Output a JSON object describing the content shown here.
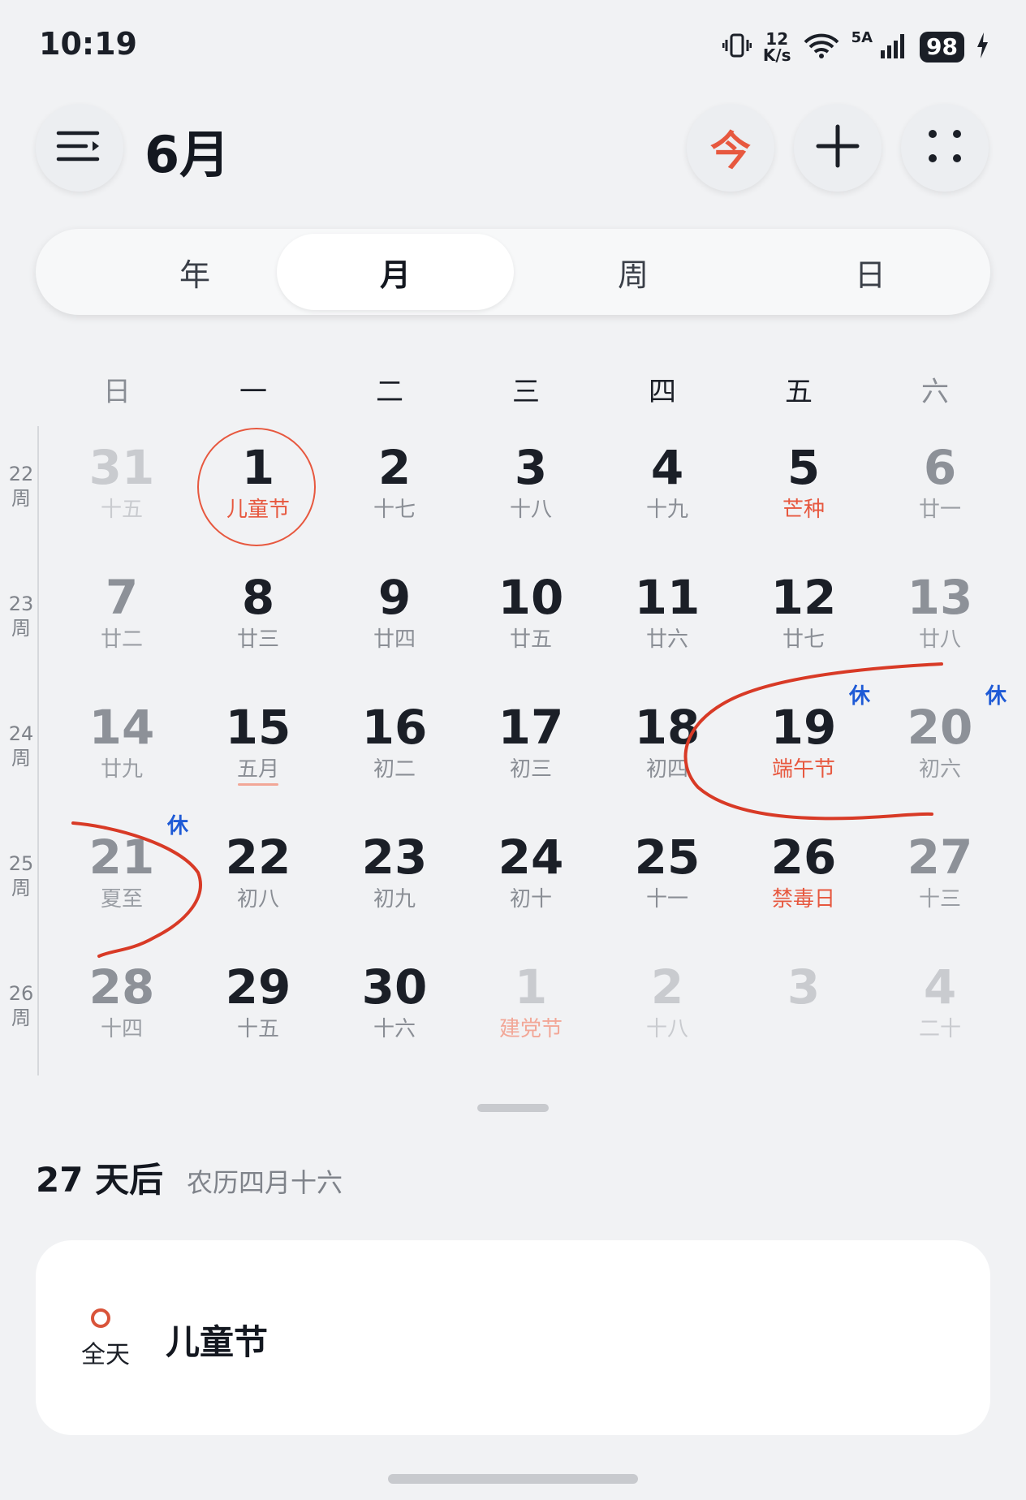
{
  "status_bar": {
    "time": "10:19",
    "net_speed_value": "12",
    "net_speed_unit": "K/s",
    "signal_label": "5A",
    "battery": "98"
  },
  "header": {
    "month_title": "6月",
    "today_label": "今",
    "icons": [
      "menu-icon",
      "today-icon",
      "plus-icon",
      "more-grid-icon"
    ]
  },
  "view_tabs": [
    {
      "label": "年",
      "active": false
    },
    {
      "label": "月",
      "active": true
    },
    {
      "label": "周",
      "active": false
    },
    {
      "label": "日",
      "active": false
    }
  ],
  "weekdays": [
    "日",
    "一",
    "二",
    "三",
    "四",
    "五",
    "六"
  ],
  "weeks": [
    {
      "label": "22\n周",
      "days": [
        {
          "day": "31",
          "lunar": "十五",
          "dim": true
        },
        {
          "day": "1",
          "lunar": "儿童节",
          "holiday": true,
          "today": true
        },
        {
          "day": "2",
          "lunar": "十七"
        },
        {
          "day": "3",
          "lunar": "十八"
        },
        {
          "day": "4",
          "lunar": "十九"
        },
        {
          "day": "5",
          "lunar": "芒种",
          "holiday": true
        },
        {
          "day": "6",
          "lunar": "廿一"
        }
      ]
    },
    {
      "label": "23\n周",
      "days": [
        {
          "day": "7",
          "lunar": "廿二"
        },
        {
          "day": "8",
          "lunar": "廿三"
        },
        {
          "day": "9",
          "lunar": "廿四"
        },
        {
          "day": "10",
          "lunar": "廿五"
        },
        {
          "day": "11",
          "lunar": "廿六"
        },
        {
          "day": "12",
          "lunar": "廿七"
        },
        {
          "day": "13",
          "lunar": "廿八"
        }
      ]
    },
    {
      "label": "24\n周",
      "days": [
        {
          "day": "14",
          "lunar": "廿九"
        },
        {
          "day": "15",
          "lunar": "五月",
          "underline": true
        },
        {
          "day": "16",
          "lunar": "初二"
        },
        {
          "day": "17",
          "lunar": "初三"
        },
        {
          "day": "18",
          "lunar": "初四"
        },
        {
          "day": "19",
          "lunar": "端午节",
          "holiday": true,
          "rest": "休"
        },
        {
          "day": "20",
          "lunar": "初六",
          "rest": "休"
        }
      ]
    },
    {
      "label": "25\n周",
      "days": [
        {
          "day": "21",
          "lunar": "夏至",
          "holiday": true,
          "rest": "休"
        },
        {
          "day": "22",
          "lunar": "初八"
        },
        {
          "day": "23",
          "lunar": "初九"
        },
        {
          "day": "24",
          "lunar": "初十"
        },
        {
          "day": "25",
          "lunar": "十一"
        },
        {
          "day": "26",
          "lunar": "禁毒日",
          "holiday": true
        },
        {
          "day": "27",
          "lunar": "十三"
        }
      ]
    },
    {
      "label": "26\n周",
      "days": [
        {
          "day": "28",
          "lunar": "十四"
        },
        {
          "day": "29",
          "lunar": "十五"
        },
        {
          "day": "30",
          "lunar": "十六"
        },
        {
          "day": "1",
          "lunar": "建党节",
          "holiday": true,
          "dim": true
        },
        {
          "day": "2",
          "lunar": "十八",
          "dim": true
        },
        {
          "day": "3",
          "lunar": "",
          "dim": true
        },
        {
          "day": "4",
          "lunar": "二十",
          "dim": true
        }
      ]
    }
  ],
  "detail": {
    "countdown": "27 天后",
    "lunar_date": "农历四月十六"
  },
  "event": {
    "all_day_label": "全天",
    "title": "儿童节",
    "dot_color": "#d9543a"
  },
  "colors": {
    "accent": "#e7583f",
    "rest_badge": "#1e5ad6",
    "annotation_ink": "#d83a26"
  }
}
